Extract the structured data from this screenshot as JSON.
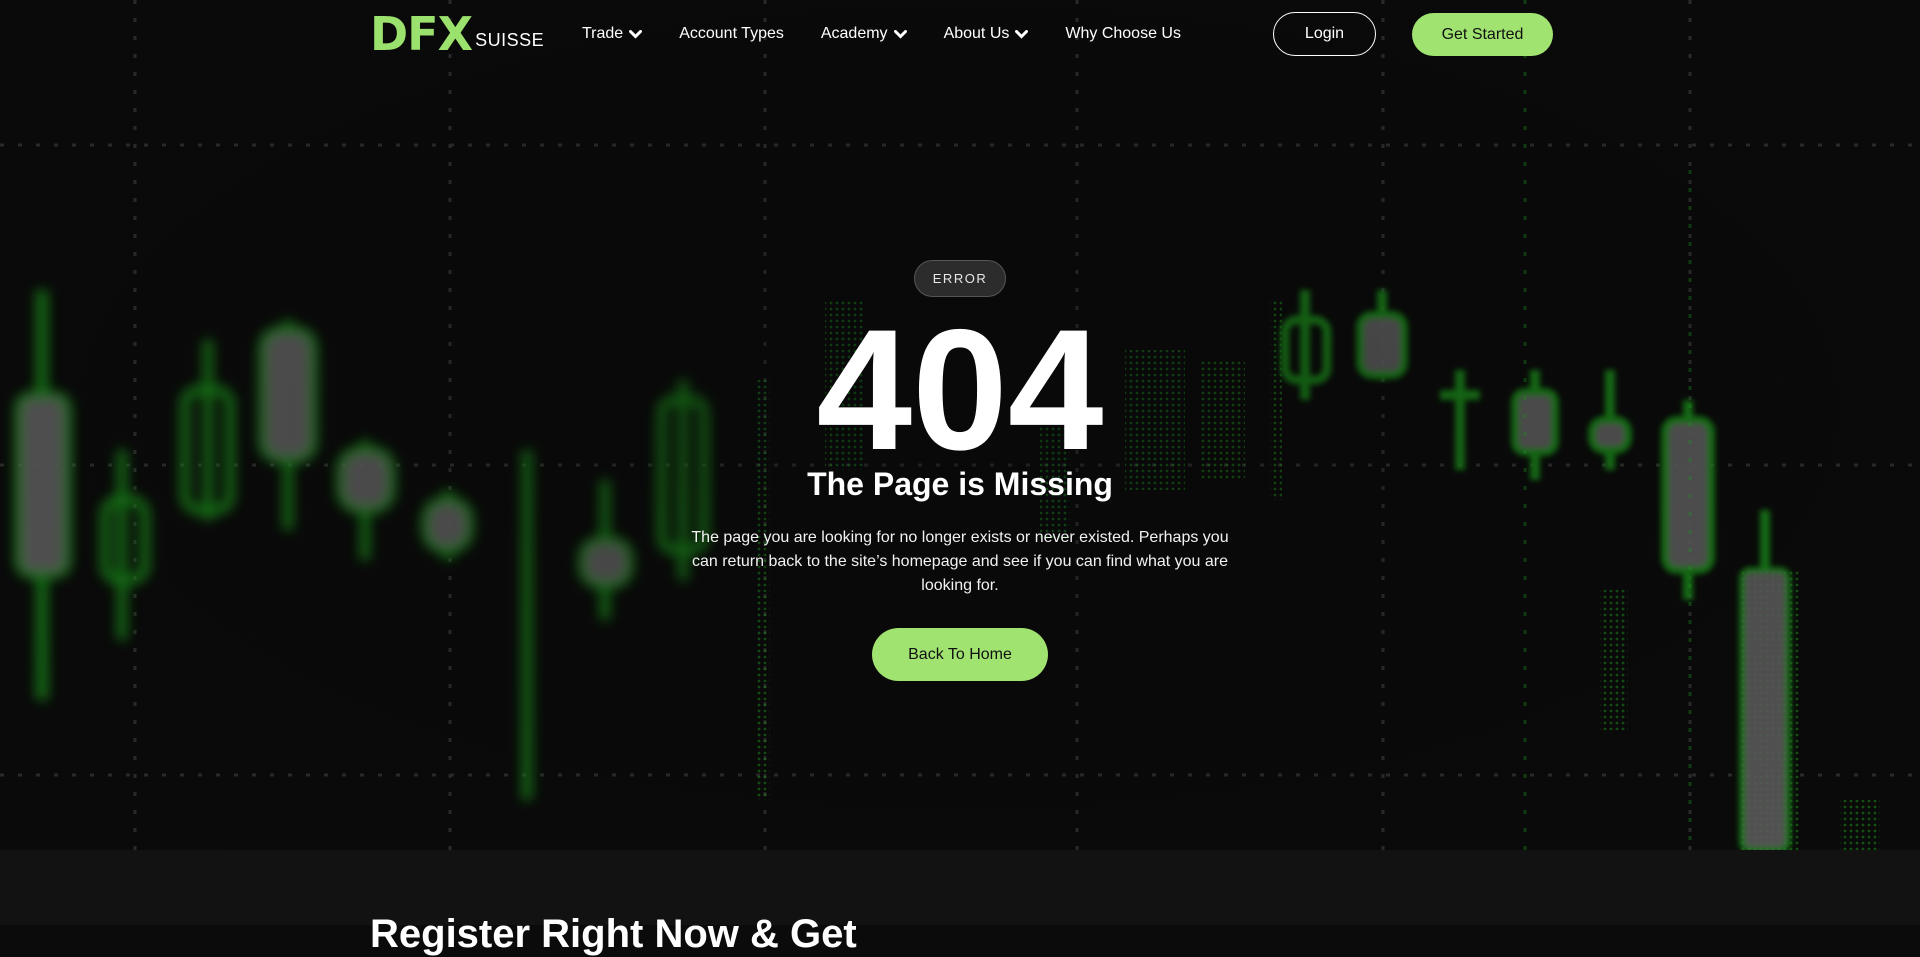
{
  "brand": {
    "name": "DFX",
    "suffix": "SUISSE",
    "accent": "#a0e371"
  },
  "nav": {
    "items": [
      {
        "label": "Trade",
        "dropdown": true
      },
      {
        "label": "Account Types",
        "dropdown": false
      },
      {
        "label": "Academy",
        "dropdown": true
      },
      {
        "label": "About Us",
        "dropdown": true
      },
      {
        "label": "Why Choose Us",
        "dropdown": false
      }
    ],
    "login_label": "Login",
    "get_started_label": "Get Started"
  },
  "error": {
    "badge": "ERROR",
    "code": "404",
    "title": "The Page is Missing",
    "description": "The page you are looking for no longer exists or never existed. Perhaps you can return back to the site’s homepage and see if you can find what you are looking for.",
    "button_label": "Back To Home"
  },
  "next_section": {
    "heading": "Register Right Now & Get"
  },
  "icons": {
    "dropdown": "chevron-down-icon"
  },
  "colors": {
    "background": "#0a0a0a",
    "candle_green": "#2bd62b",
    "candle_grey": "#8a8a8a"
  }
}
